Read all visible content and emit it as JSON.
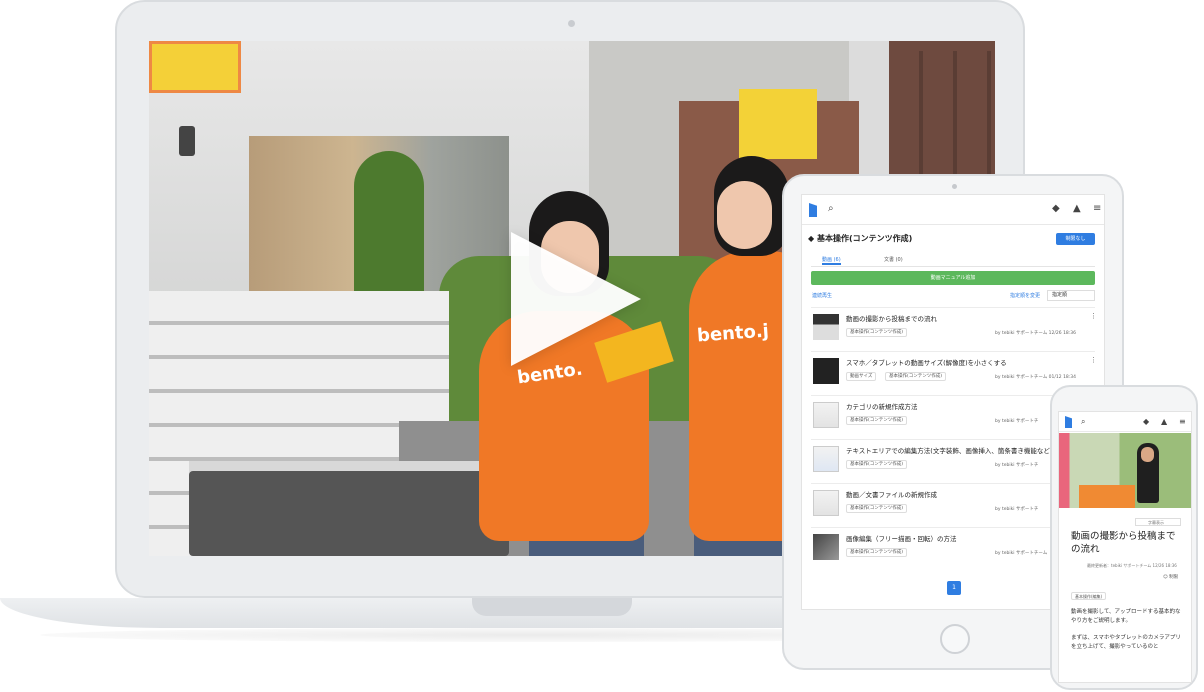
{
  "laptop": {
    "shirt_text_left": "bento.",
    "shirt_text_right": "bento.j"
  },
  "tablet": {
    "header_title": "基本操作(コンテンツ作成)",
    "restrict_button": "制限なし",
    "tabs": [
      {
        "label": "動画 (6)",
        "active": true
      },
      {
        "label": "文書 (0)",
        "active": false
      }
    ],
    "add_button": "動画マニュアル追加",
    "continuous_play": "連続再生",
    "change_order": "指定順を変更",
    "sort_label": "指定順",
    "items": [
      {
        "title": "動画の撮影から投稿までの流れ",
        "tags": [
          "基本操作(コンテンツ作成)"
        ],
        "meta": "by tebiki サポートチーム 12/26 18:36"
      },
      {
        "title": "スマホ／タブレットの動画サイズ(解像度)を小さくする",
        "tags": [
          "動画サイズ",
          "基本操作(コンテンツ作成)"
        ],
        "meta": "by tebiki サポートチーム 01/12 18:34"
      },
      {
        "title": "カテゴリの新規作成方法",
        "tags": [
          "基本操作(コンテンツ作成)"
        ],
        "meta": "by tebiki サポートチ"
      },
      {
        "title": "テキストエリアでの編集方法(文字装飾、画像挿入、箇条書き機能など",
        "tags": [
          "基本操作(コンテンツ作成)"
        ],
        "meta": "by tebiki サポートチ"
      },
      {
        "title": "動画／文書ファイルの新規作成",
        "tags": [
          "基本操作(コンテンツ作成)"
        ],
        "meta": "by tebiki サポートチ"
      },
      {
        "title": "画像編集（フリー描画・回転）の方法",
        "tags": [
          "基本操作(コンテンツ作成)"
        ],
        "meta": "by tebiki サポートチーム"
      }
    ],
    "page_number": "1"
  },
  "phone": {
    "select_label": "字幕表示",
    "title": "動画の撮影から投稿までの流れ",
    "meta": "最終更新者：tebiki サポートチーム 12/26 18:36",
    "restrict": "制限",
    "tag": "基本操作(編集)",
    "body_1": "動画を撮影して、アップロードする基本的なやり方をご説明します。",
    "body_2": "まずは、スマホやタブレットのカメラアプリを立ち上げて、撮影やっているのと"
  },
  "icons": {
    "search": "search-icon",
    "tag": "tag-icon",
    "bell": "bell-icon",
    "menu": "menu-icon",
    "play": "play-icon"
  },
  "colors": {
    "accent": "#2f7de1",
    "add_button": "#5cb85c",
    "shirt": "#f07826"
  }
}
